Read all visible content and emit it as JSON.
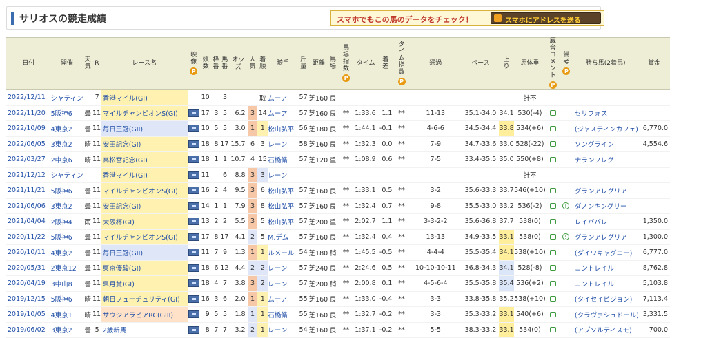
{
  "header": {
    "title": "サリオスの競走成績",
    "promo_text": "スマホでもこの馬のデータをチェック！",
    "promo_button": "スマホにアドレスを送る"
  },
  "table": {
    "columns": [
      "日付",
      "開催",
      "天気",
      "R",
      "レース名",
      "映像",
      "頭数",
      "枠番",
      "馬番",
      "オッズ",
      "人気",
      "着順",
      "騎手",
      "斤量",
      "距離",
      "馬場",
      "馬場指数",
      "タイム",
      "着差",
      "タイム指数",
      "通過",
      "ペース",
      "上り",
      "馬体重",
      "厩舎コメント",
      "備考",
      "勝ち馬(2着馬)",
      "賞金"
    ],
    "badge": "P",
    "rows": [
      {
        "date": "2022/12/11",
        "track": "シャティン",
        "weather": "",
        "r": "7",
        "race": "香港マイル(GI)",
        "grade": "g1",
        "video": false,
        "field": "10",
        "gate": "",
        "num": "3",
        "odds": "",
        "pop": "",
        "fin": "取",
        "jockey": "ムーア",
        "wt": "57",
        "dist": "芝1600",
        "cond": "良",
        "idx": "",
        "time": "",
        "diff": "",
        "tidx": "",
        "pass": "",
        "pace": "",
        "last3": "",
        "body": "計不",
        "cmt": false,
        "note": false,
        "winner": "",
        "prize": "",
        "popc": "",
        "finc": "",
        "l3c": ""
      },
      {
        "date": "2022/11/20",
        "track": "5阪神6",
        "weather": "曇",
        "r": "11",
        "race": "マイルチャンピオンS(GI)",
        "grade": "g1",
        "video": true,
        "field": "17",
        "gate": "3",
        "num": "5",
        "odds": "6.2",
        "pop": "3",
        "fin": "14",
        "jockey": "ムーア",
        "wt": "57",
        "dist": "芝1600",
        "cond": "良",
        "idx": "**",
        "time": "1:33.6",
        "diff": "1.1",
        "tidx": "**",
        "pass": "11-13",
        "pace": "35.1-34.0",
        "last3": "34.1",
        "body": "530(-4)",
        "cmt": true,
        "note": false,
        "winner": "セリフォス",
        "prize": "",
        "popc": "top",
        "finc": "",
        "l3c": ""
      },
      {
        "date": "2022/10/09",
        "track": "4東京2",
        "weather": "曇",
        "r": "11",
        "race": "毎日王冠(GII)",
        "grade": "g2",
        "video": true,
        "field": "10",
        "gate": "5",
        "num": "5",
        "odds": "3.0",
        "pop": "1",
        "fin": "1",
        "jockey": "松山弘平",
        "wt": "56",
        "dist": "芝1800",
        "cond": "良",
        "idx": "**",
        "time": "1:44.1",
        "diff": "-0.1",
        "tidx": "**",
        "pass": "4-6-6",
        "pace": "34.5-34.4",
        "last3": "33.8",
        "body": "534(+6)",
        "cmt": true,
        "note": false,
        "winner": "(ジャスティンカフェ)",
        "prize": "6,770.0",
        "popc": "top",
        "finc": "win",
        "l3c": "best"
      },
      {
        "date": "2022/06/05",
        "track": "3東京2",
        "weather": "晴",
        "r": "11",
        "race": "安田記念(GI)",
        "grade": "g1",
        "video": true,
        "field": "18",
        "gate": "8",
        "num": "17",
        "odds": "15.7",
        "pop": "6",
        "fin": "3",
        "jockey": "レーン",
        "wt": "58",
        "dist": "芝1600",
        "cond": "良",
        "idx": "**",
        "time": "1:32.3",
        "diff": "0.0",
        "tidx": "**",
        "pass": "7-9",
        "pace": "34.7-33.6",
        "last3": "33.0",
        "body": "528(-22)",
        "cmt": true,
        "note": false,
        "winner": "ソングライン",
        "prize": "4,554.6",
        "popc": "",
        "finc": "",
        "l3c": ""
      },
      {
        "date": "2022/03/27",
        "track": "2中京6",
        "weather": "晴",
        "r": "11",
        "race": "高松宮記念(GI)",
        "grade": "g1",
        "video": true,
        "field": "18",
        "gate": "1",
        "num": "1",
        "odds": "10.7",
        "pop": "4",
        "fin": "15",
        "jockey": "石橋脩",
        "wt": "57",
        "dist": "芝1200",
        "cond": "重",
        "idx": "**",
        "time": "1:08.9",
        "diff": "0.6",
        "tidx": "**",
        "pass": "7-5",
        "pace": "33.4-35.5",
        "last3": "35.0",
        "body": "550(+8)",
        "cmt": true,
        "note": false,
        "winner": "ナランフレグ",
        "prize": "",
        "popc": "",
        "finc": "",
        "l3c": ""
      },
      {
        "date": "2021/12/12",
        "track": "シャティン",
        "weather": "",
        "r": "",
        "race": "香港マイル(GI)",
        "grade": "g1",
        "video": true,
        "field": "11",
        "gate": "",
        "num": "6",
        "odds": "8.8",
        "pop": "3",
        "fin": "3",
        "jockey": "レーン",
        "wt": "",
        "dist": "",
        "cond": "",
        "idx": "",
        "time": "",
        "diff": "",
        "tidx": "",
        "pass": "",
        "pace": "",
        "last3": "",
        "body": "計不",
        "cmt": false,
        "note": false,
        "winner": "",
        "prize": "",
        "popc": "top",
        "finc": "place",
        "l3c": ""
      },
      {
        "date": "2021/11/21",
        "track": "5阪神6",
        "weather": "曇",
        "r": "11",
        "race": "マイルチャンピオンS(GI)",
        "grade": "g1",
        "video": true,
        "field": "16",
        "gate": "2",
        "num": "4",
        "odds": "9.5",
        "pop": "3",
        "fin": "6",
        "jockey": "松山弘平",
        "wt": "57",
        "dist": "芝1600",
        "cond": "良",
        "idx": "**",
        "time": "1:33.1",
        "diff": "0.5",
        "tidx": "**",
        "pass": "3-2",
        "pace": "35.6-33.3",
        "last3": "33.7",
        "body": "546(+10)",
        "cmt": true,
        "note": false,
        "winner": "グランアレグリア",
        "prize": "",
        "popc": "top",
        "finc": "",
        "l3c": ""
      },
      {
        "date": "2021/06/06",
        "track": "3東京2",
        "weather": "曇",
        "r": "11",
        "race": "安田記念(GI)",
        "grade": "g1",
        "video": true,
        "field": "14",
        "gate": "1",
        "num": "1",
        "odds": "7.9",
        "pop": "3",
        "fin": "8",
        "jockey": "松山弘平",
        "wt": "57",
        "dist": "芝1600",
        "cond": "良",
        "idx": "**",
        "time": "1:32.4",
        "diff": "0.7",
        "tidx": "**",
        "pass": "9-8",
        "pace": "35.5-33.0",
        "last3": "33.2",
        "body": "536(-2)",
        "cmt": true,
        "note": true,
        "winner": "ダノンキングリー",
        "prize": "",
        "popc": "top",
        "finc": "",
        "l3c": ""
      },
      {
        "date": "2021/04/04",
        "track": "2阪神4",
        "weather": "雨",
        "r": "11",
        "race": "大阪杯(GI)",
        "grade": "g1",
        "video": true,
        "field": "13",
        "gate": "2",
        "num": "2",
        "odds": "5.5",
        "pop": "3",
        "fin": "5",
        "jockey": "松山弘平",
        "wt": "57",
        "dist": "芝2000",
        "cond": "重",
        "idx": "**",
        "time": "2:02.7",
        "diff": "1.1",
        "tidx": "**",
        "pass": "3-3-2-2",
        "pace": "35.6-36.8",
        "last3": "37.7",
        "body": "538(0)",
        "cmt": true,
        "note": false,
        "winner": "レイパパレ",
        "prize": "1,350.0",
        "popc": "top",
        "finc": "",
        "l3c": ""
      },
      {
        "date": "2020/11/22",
        "track": "5阪神6",
        "weather": "曇",
        "r": "11",
        "race": "マイルチャンピオンS(GI)",
        "grade": "g1",
        "video": true,
        "field": "17",
        "gate": "8",
        "num": "17",
        "odds": "4.1",
        "pop": "2",
        "fin": "5",
        "jockey": "M.デム",
        "wt": "57",
        "dist": "芝1600",
        "cond": "良",
        "idx": "**",
        "time": "1:32.4",
        "diff": "0.4",
        "tidx": "**",
        "pass": "13-13",
        "pace": "34.9-33.5",
        "last3": "33.1",
        "body": "538(0)",
        "cmt": true,
        "note": true,
        "winner": "グランアレグリア",
        "prize": "1,300.0",
        "popc": "sec",
        "finc": "",
        "l3c": "best"
      },
      {
        "date": "2020/10/11",
        "track": "4東京2",
        "weather": "曇",
        "r": "11",
        "race": "毎日王冠(GII)",
        "grade": "g2",
        "video": true,
        "field": "11",
        "gate": "7",
        "num": "9",
        "odds": "1.3",
        "pop": "1",
        "fin": "1",
        "jockey": "ルメール",
        "wt": "54",
        "dist": "芝1800",
        "cond": "稍",
        "idx": "**",
        "time": "1:45.5",
        "diff": "-0.5",
        "tidx": "**",
        "pass": "4-4-4",
        "pace": "35.5-35.4",
        "last3": "34.1",
        "body": "538(+10)",
        "cmt": true,
        "note": false,
        "winner": "(ダイワキャグニー)",
        "prize": "6,777.0",
        "popc": "top",
        "finc": "win",
        "l3c": "best"
      },
      {
        "date": "2020/05/31",
        "track": "2東京12",
        "weather": "曇",
        "r": "11",
        "race": "東京優駿(GI)",
        "grade": "g1",
        "video": true,
        "field": "18",
        "gate": "6",
        "num": "12",
        "odds": "4.4",
        "pop": "2",
        "fin": "2",
        "jockey": "レーン",
        "wt": "57",
        "dist": "芝2400",
        "cond": "良",
        "idx": "**",
        "time": "2:24.6",
        "diff": "0.5",
        "tidx": "**",
        "pass": "10-10-10-11",
        "pace": "36.8-34.3",
        "last3": "34.1",
        "body": "528(-8)",
        "cmt": true,
        "note": false,
        "winner": "コントレイル",
        "prize": "8,762.8",
        "popc": "sec",
        "finc": "place",
        "l3c": "second"
      },
      {
        "date": "2020/04/19",
        "track": "3中山8",
        "weather": "曇",
        "r": "11",
        "race": "皐月賞(GI)",
        "grade": "g1",
        "video": true,
        "field": "18",
        "gate": "4",
        "num": "7",
        "odds": "3.8",
        "pop": "3",
        "fin": "2",
        "jockey": "レーン",
        "wt": "57",
        "dist": "芝2000",
        "cond": "稍",
        "idx": "**",
        "time": "2:00.8",
        "diff": "0.1",
        "tidx": "**",
        "pass": "4-5-6-4",
        "pace": "35.5-35.8",
        "last3": "35.4",
        "body": "536(+2)",
        "cmt": true,
        "note": false,
        "winner": "コントレイル",
        "prize": "5,103.8",
        "popc": "top",
        "finc": "place",
        "l3c": "second"
      },
      {
        "date": "2019/12/15",
        "track": "5阪神6",
        "weather": "晴",
        "r": "11",
        "race": "朝日フューチュリティ(GI)",
        "grade": "g1",
        "video": true,
        "field": "16",
        "gate": "3",
        "num": "6",
        "odds": "2.0",
        "pop": "1",
        "fin": "1",
        "jockey": "ムーア",
        "wt": "55",
        "dist": "芝1600",
        "cond": "良",
        "idx": "**",
        "time": "1:33.0",
        "diff": "-0.4",
        "tidx": "**",
        "pass": "3-3",
        "pace": "33.8-35.8",
        "last3": "35.2",
        "body": "538(+10)",
        "cmt": true,
        "note": false,
        "winner": "(タイセイビジョン)",
        "prize": "7,113.4",
        "popc": "top",
        "finc": "win",
        "l3c": ""
      },
      {
        "date": "2019/10/05",
        "track": "4東京1",
        "weather": "晴",
        "r": "11",
        "race": "サウジアラビアRC(GIII)",
        "grade": "g3",
        "video": true,
        "field": "9",
        "gate": "5",
        "num": "5",
        "odds": "1.8",
        "pop": "1",
        "fin": "1",
        "jockey": "石橋脩",
        "wt": "55",
        "dist": "芝1600",
        "cond": "良",
        "idx": "**",
        "time": "1:32.7",
        "diff": "-0.2",
        "tidx": "**",
        "pass": "3-3",
        "pace": "35.3-33.2",
        "last3": "33.1",
        "body": "540(+6)",
        "cmt": true,
        "note": false,
        "winner": "(クラヴァシュドール)",
        "prize": "3,331.5",
        "popc": "sec",
        "finc": "win",
        "l3c": "best"
      },
      {
        "date": "2019/06/02",
        "track": "3東京2",
        "weather": "曇",
        "r": "5",
        "race": "2歳新馬",
        "grade": "open",
        "video": true,
        "field": "8",
        "gate": "7",
        "num": "7",
        "odds": "3.2",
        "pop": "2",
        "fin": "1",
        "jockey": "レーン",
        "wt": "54",
        "dist": "芝1600",
        "cond": "良",
        "idx": "**",
        "time": "1:37.1",
        "diff": "-0.2",
        "tidx": "**",
        "pass": "5-5",
        "pace": "38.3-33.2",
        "last3": "33.1",
        "body": "534(0)",
        "cmt": true,
        "note": false,
        "winner": "(アブソルティスモ)",
        "prize": "700.0",
        "popc": "sec",
        "finc": "win",
        "l3c": "best"
      }
    ]
  }
}
